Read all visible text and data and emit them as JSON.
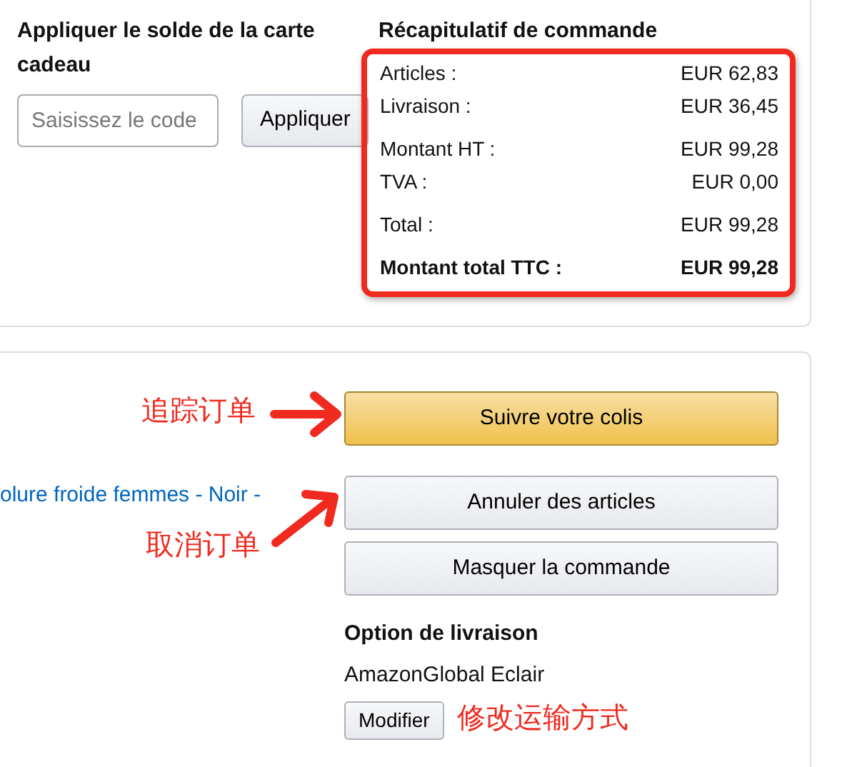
{
  "gift_card": {
    "title": "Appliquer le solde de la carte cadeau",
    "placeholder": "Saisissez le code",
    "button": "Appliquer"
  },
  "order_summary": {
    "title": "Récapitulatif de commande",
    "groups": [
      [
        {
          "label": "Articles :",
          "value": "EUR 62,83",
          "kind": "line"
        },
        {
          "label": "Livraison :",
          "value": "EUR 36,45",
          "kind": "line"
        }
      ],
      [
        {
          "label": "Montant HT :",
          "value": "EUR 99,28",
          "kind": "line"
        },
        {
          "label": "TVA :",
          "value": "EUR 0,00",
          "kind": "line"
        }
      ],
      [
        {
          "label": "Total :",
          "value": "EUR 99,28",
          "kind": "line"
        }
      ],
      [
        {
          "label": "Montant total TTC :",
          "value": "EUR 99,28",
          "kind": "total"
        }
      ]
    ]
  },
  "shipment": {
    "item_link": "olure froide femmes - Noir -",
    "actions": [
      {
        "label": "Suivre votre colis",
        "kind": "primary"
      },
      {
        "label": "Annuler des articles",
        "kind": "secondary"
      },
      {
        "label": "Masquer la commande",
        "kind": "secondary"
      }
    ],
    "delivery_title": "Option de livraison",
    "delivery_option": "AmazonGlobal Eclair",
    "change_button": "Modifier"
  },
  "annotations": [
    {
      "text": "追踪订单",
      "kind": "arrowright"
    },
    {
      "text": "取消订单",
      "kind": "arrowup"
    },
    {
      "text": "修改运输方式",
      "kind": "plain"
    }
  ]
}
